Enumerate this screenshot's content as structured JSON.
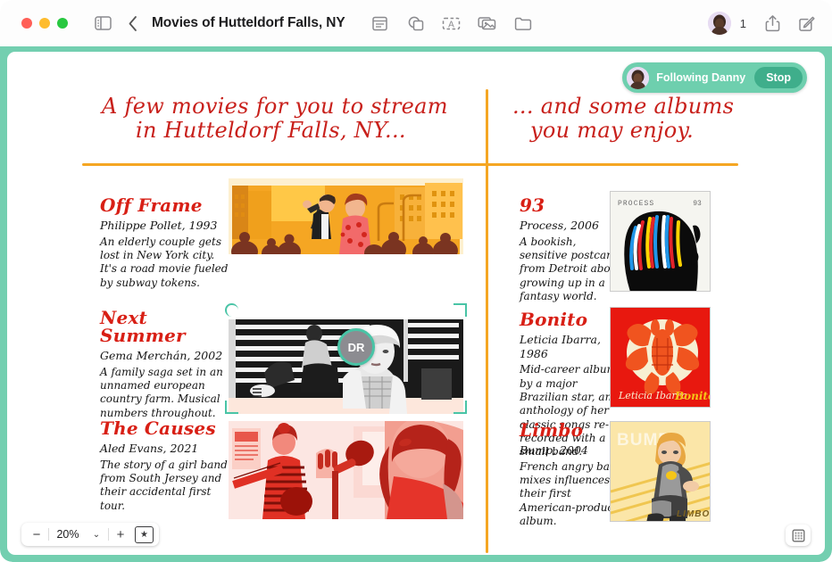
{
  "window": {
    "title": "Movies of Hutteldorf Falls, NY",
    "traffic_lights": [
      "close",
      "minimize",
      "zoom"
    ],
    "toolbar_icons": [
      "sidebar-icon",
      "back-icon",
      "note-icon",
      "shapes-icon",
      "text-box-icon",
      "media-icon",
      "folder-icon",
      "share-icon",
      "compose-icon"
    ],
    "collaborator_count": "1"
  },
  "collaboration": {
    "following_label": "Following Danny",
    "stop_label": "Stop",
    "cursor_initials": "DR",
    "accent_color": "#6ecfae",
    "stop_color": "#3fae8b",
    "selection_color": "#49c4a6"
  },
  "board": {
    "divider_color": "#f5a623",
    "headings": {
      "left": {
        "line1": "A few movies for you to stream",
        "line2": "in Hutteldorf Falls, NY..."
      },
      "right": {
        "line1": "... and some albums",
        "line2": "you may enjoy."
      }
    },
    "movies": [
      {
        "title": "Off Frame",
        "credit": "Philippe Pollet, 1993",
        "description": "An elderly couple gets lost in New York city. It's a road movie fueled by subway tokens.",
        "artwork": "city-street-couple-hailing-taxi"
      },
      {
        "title": "Next Summer",
        "credit": "Gema Merchán, 2002",
        "description": "A family saga set in an unnamed european country farm. Musical numbers throughout.",
        "artwork": "black-and-white-woman-in-headscarf",
        "selected": true
      },
      {
        "title": "The Causes",
        "credit": "Aled Evans, 2021",
        "description": "The story of a girl band from South Jersey and their accidental first tour.",
        "artwork": "red-toned-band-singing"
      }
    ],
    "albums": [
      {
        "title": "93",
        "credit": "Process, 2006",
        "description": "A bookish, sensitive postcard from Detroit about growing up in a fantasy world.",
        "cover": {
          "artist_text": "PROCESS",
          "title_text": "93",
          "art": "black-silhouette-colorful-dreadlocks"
        }
      },
      {
        "title": "Bonito",
        "credit": "Leticia Ibarra, 1986",
        "description": "Mid-career album by a major Brazilian star, an anthology of her classic songs re-recorded with a small band.",
        "cover": {
          "artist_text": "Leticia Ibarra",
          "title_text": "Bonito",
          "art": "orange-lobster-on-red"
        }
      },
      {
        "title": "Limbo",
        "credit": "Bump, 2004",
        "description": "French angry band mixes influences in their first American-produced album.",
        "cover": {
          "artist_text": "BUMP",
          "title_text": "LIMBO",
          "art": "figure-in-grey-wetsuit-on-yellow"
        }
      }
    ]
  },
  "bottom_bar": {
    "zoom_out": "−",
    "zoom_value": "20%",
    "zoom_in": "+",
    "chevron": "⌄",
    "star_label": "★",
    "grid_icon": "grid-view-icon"
  }
}
